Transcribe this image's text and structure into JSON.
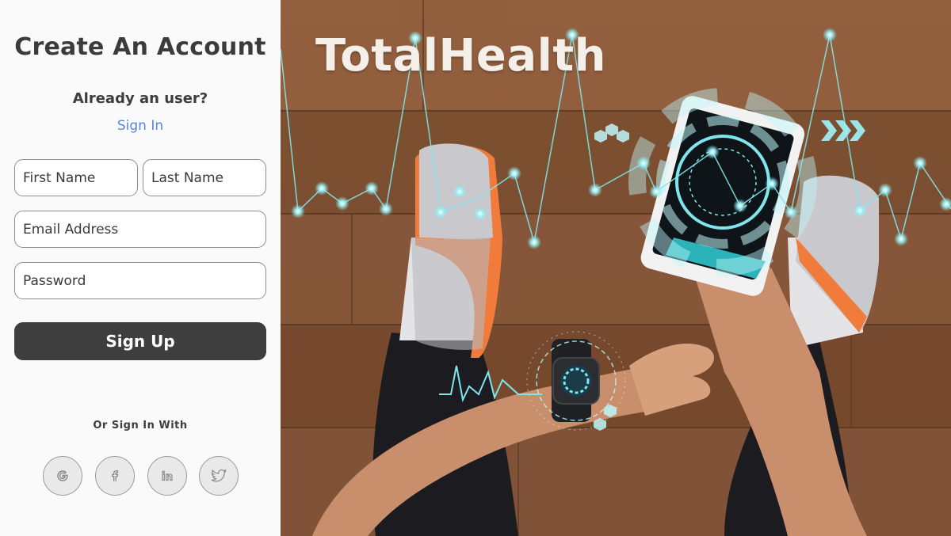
{
  "form": {
    "title": "Create An Account",
    "already_user": "Already an user?",
    "signin_link": "Sign In",
    "first_name_placeholder": "First Name",
    "last_name_placeholder": "Last Name",
    "email_placeholder": "Email Address",
    "password_placeholder": "Password",
    "signup_label": "Sign Up",
    "or_signin_with": "Or Sign In With"
  },
  "social": [
    {
      "icon": "google-icon"
    },
    {
      "icon": "facebook-icon"
    },
    {
      "icon": "linkedin-icon"
    },
    {
      "icon": "twitter-icon"
    }
  ],
  "hero": {
    "brand": "TotalHealth"
  },
  "colors": {
    "accent_link": "#5c84e0",
    "button_bg": "#3e3e3e",
    "panel_bg": "#fafafa",
    "glow": "#7fe6ee"
  }
}
